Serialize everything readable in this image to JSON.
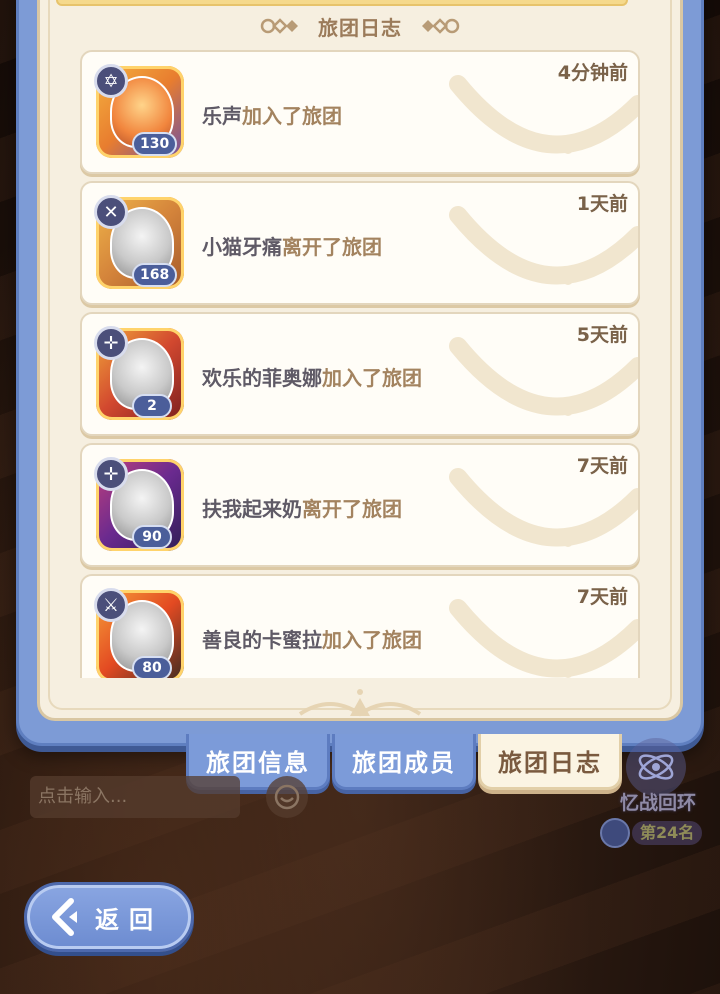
{
  "header": {
    "title": "旅团日志"
  },
  "log_entries": [
    {
      "name": "乐声",
      "action": "加入了旅团",
      "time": "4分钟前",
      "level": "130"
    },
    {
      "name": "小猫牙痛",
      "action": "离开了旅团",
      "time": "1天前",
      "level": "168"
    },
    {
      "name": "欢乐的菲奥娜",
      "action": "加入了旅团",
      "time": "5天前",
      "level": "2"
    },
    {
      "name": "扶我起来奶",
      "action": "离开了旅团",
      "time": "7天前",
      "level": "90"
    },
    {
      "name": "善良的卡蜜拉",
      "action": "加入了旅团",
      "time": "7天前",
      "level": "80"
    }
  ],
  "tabs": [
    {
      "label": "旅团信息",
      "active": false
    },
    {
      "label": "旅团成员",
      "active": false
    },
    {
      "label": "旅团日志",
      "active": true
    }
  ],
  "chat": {
    "placeholder": "点击输入..."
  },
  "event": {
    "title": "忆战回环",
    "rank": "第24名"
  },
  "back_button": {
    "label": "返回"
  },
  "colors": {
    "panel_blue": "#7d9bd6",
    "parchment": "#f6efe0",
    "name_text": "#5f5a66",
    "action_text": "#a3835f"
  }
}
